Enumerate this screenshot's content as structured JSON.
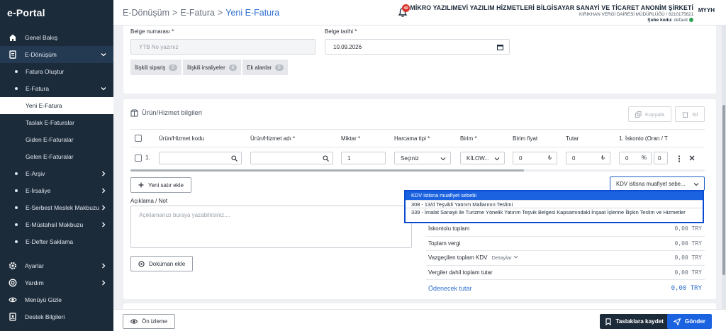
{
  "app": {
    "logo": "e-Portal"
  },
  "sidebar": {
    "items": [
      {
        "label": "Genel Bakış",
        "icon": "home-icon"
      },
      {
        "label": "E-Dönüşüm",
        "icon": "document-icon"
      },
      {
        "label": "Fatura Oluştur"
      },
      {
        "label": "E-Fatura"
      },
      {
        "label": "Yeni E-Fatura"
      },
      {
        "label": "Taslak E-Faturalar"
      },
      {
        "label": "Giden E-Faturalar"
      },
      {
        "label": "Gelen E-Faturalar"
      },
      {
        "label": "E-Arşiv"
      },
      {
        "label": "E-İrsaliye"
      },
      {
        "label": "E-Serbest Meslek Makbuzu"
      },
      {
        "label": "E-Müstahsil Makbuzu"
      },
      {
        "label": "E-Defter Saklama"
      },
      {
        "label": "Ayarlar",
        "icon": "gear-icon"
      },
      {
        "label": "Yardım",
        "icon": "help-icon"
      },
      {
        "label": "Menüyü Gizle",
        "icon": "hide-menu-icon"
      },
      {
        "label": "Destek Bilgileri",
        "icon": "support-icon"
      }
    ]
  },
  "header": {
    "breadcrumb": [
      "E-Dönüşüm",
      "E-Fatura",
      "Yeni E-Fatura"
    ],
    "separator": ">",
    "notifications": "40",
    "company_name": "MİKRO YAZILIMEVİ YAZILIM HİZMETLERİ BİLGİSAYAR SANAYİ VE TİCARET ANONİM ŞİRKETİ",
    "tax_info": "KIRIKHAN VERGİ DAİRESİ MÜDÜRLÜĞÜ / 6210175621",
    "branch_label": "Şube kodu:",
    "branch_value": "default",
    "avatar": "MYYH"
  },
  "form": {
    "doc_no_label": "Belge numarası *",
    "doc_no_placeholder": "YTB No yazınız",
    "doc_date_label": "Belge tarihi *",
    "doc_date_value": "10.09.2026",
    "tabs": [
      {
        "label": "İlişkili sipariş",
        "count": "0"
      },
      {
        "label": "İlişkili irsaliyeler",
        "count": "0"
      },
      {
        "label": "Ek alanlar",
        "count": "0"
      }
    ]
  },
  "products": {
    "title": "Ürün/Hizmet bilgileri",
    "copy_label": "Kopyala",
    "delete_label": "Sil",
    "columns": [
      "Ürün/Hizmet kodu",
      "Ürün/Hizmet adı *",
      "Miktar *",
      "Harcama tipi *",
      "Birim *",
      "Birim fiyat",
      "Tutar",
      "1. İskonto (Oran / T"
    ],
    "row": {
      "index": "1.",
      "quantity": "1",
      "expense_type": "Seçiniz",
      "unit": "KİLOW...",
      "unit_price": "0",
      "amount": "0",
      "discount_rate": "0",
      "discount_amount": "0",
      "currency_symbol": "₺",
      "percent_symbol": "%"
    },
    "add_row_label": "Yeni satır ekle",
    "kdv_select_value": "KDV istisna muafiyet sebe...",
    "kdv_options": [
      "KDV istisna muafiyet sebebi",
      "308 - 13/d Teşvikli Yatırım Mallarının Teslimi",
      "339 - İmalat Sanayii ile Turizme Yönelik Yatırım Teşvik Belgesi Kapsamındaki İnşaat İşlerine İlişkin Teslim ve Hizmetler"
    ]
  },
  "notes": {
    "label": "Açıklama / Not",
    "placeholder": "Açıklamanızı buraya yazabilirsiniz....",
    "attach_label": "Doküman ekle"
  },
  "totals": {
    "rows": [
      {
        "label": "İskontolu toplam",
        "value": "0,00 TRY"
      },
      {
        "label": "Toplam vergi",
        "value": "0,00 TRY"
      },
      {
        "label": "Vazgeçilen toplam KDV",
        "value": "0,00 TRY",
        "extra": "Detaylar"
      },
      {
        "label": "Vergiler dahil toplam tutar",
        "value": "0,00 TRY"
      }
    ],
    "payable_label": "Ödenecek tutar",
    "payable_value": "0,00 TRY"
  },
  "footer": {
    "preview_label": "Ön izleme",
    "save_draft_label": "Taslaklara kaydet",
    "send_label": "Gönder"
  },
  "colors": {
    "sidebar": "#1c2b3a",
    "accent": "#1a62e0",
    "dropdown_border": "#0a4bd1"
  }
}
